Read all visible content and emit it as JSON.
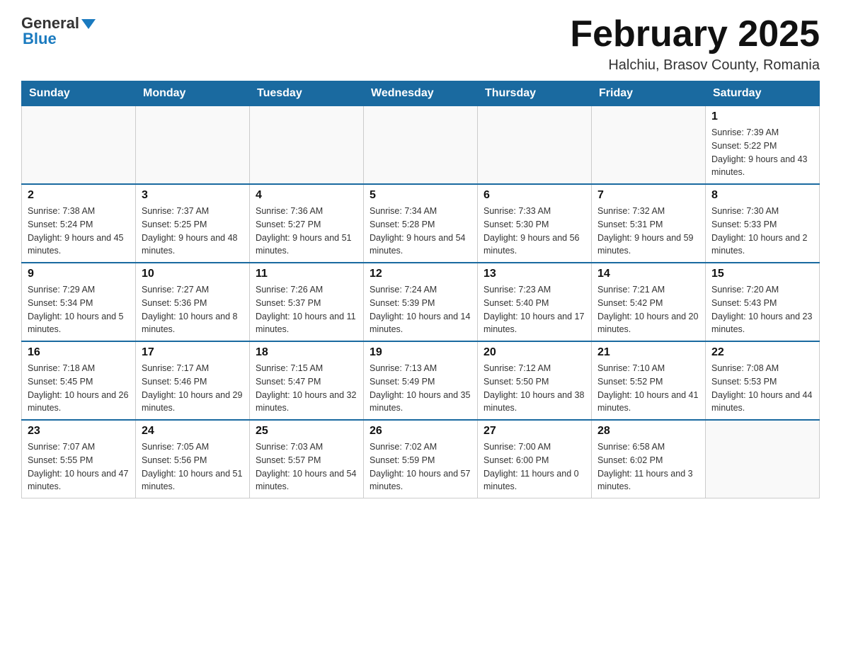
{
  "header": {
    "logo_general": "General",
    "logo_blue": "Blue",
    "title": "February 2025",
    "subtitle": "Halchiu, Brasov County, Romania"
  },
  "weekdays": [
    "Sunday",
    "Monday",
    "Tuesday",
    "Wednesday",
    "Thursday",
    "Friday",
    "Saturday"
  ],
  "weeks": [
    [
      {
        "day": "",
        "sunrise": "",
        "sunset": "",
        "daylight": ""
      },
      {
        "day": "",
        "sunrise": "",
        "sunset": "",
        "daylight": ""
      },
      {
        "day": "",
        "sunrise": "",
        "sunset": "",
        "daylight": ""
      },
      {
        "day": "",
        "sunrise": "",
        "sunset": "",
        "daylight": ""
      },
      {
        "day": "",
        "sunrise": "",
        "sunset": "",
        "daylight": ""
      },
      {
        "day": "",
        "sunrise": "",
        "sunset": "",
        "daylight": ""
      },
      {
        "day": "1",
        "sunrise": "Sunrise: 7:39 AM",
        "sunset": "Sunset: 5:22 PM",
        "daylight": "Daylight: 9 hours and 43 minutes."
      }
    ],
    [
      {
        "day": "2",
        "sunrise": "Sunrise: 7:38 AM",
        "sunset": "Sunset: 5:24 PM",
        "daylight": "Daylight: 9 hours and 45 minutes."
      },
      {
        "day": "3",
        "sunrise": "Sunrise: 7:37 AM",
        "sunset": "Sunset: 5:25 PM",
        "daylight": "Daylight: 9 hours and 48 minutes."
      },
      {
        "day": "4",
        "sunrise": "Sunrise: 7:36 AM",
        "sunset": "Sunset: 5:27 PM",
        "daylight": "Daylight: 9 hours and 51 minutes."
      },
      {
        "day": "5",
        "sunrise": "Sunrise: 7:34 AM",
        "sunset": "Sunset: 5:28 PM",
        "daylight": "Daylight: 9 hours and 54 minutes."
      },
      {
        "day": "6",
        "sunrise": "Sunrise: 7:33 AM",
        "sunset": "Sunset: 5:30 PM",
        "daylight": "Daylight: 9 hours and 56 minutes."
      },
      {
        "day": "7",
        "sunrise": "Sunrise: 7:32 AM",
        "sunset": "Sunset: 5:31 PM",
        "daylight": "Daylight: 9 hours and 59 minutes."
      },
      {
        "day": "8",
        "sunrise": "Sunrise: 7:30 AM",
        "sunset": "Sunset: 5:33 PM",
        "daylight": "Daylight: 10 hours and 2 minutes."
      }
    ],
    [
      {
        "day": "9",
        "sunrise": "Sunrise: 7:29 AM",
        "sunset": "Sunset: 5:34 PM",
        "daylight": "Daylight: 10 hours and 5 minutes."
      },
      {
        "day": "10",
        "sunrise": "Sunrise: 7:27 AM",
        "sunset": "Sunset: 5:36 PM",
        "daylight": "Daylight: 10 hours and 8 minutes."
      },
      {
        "day": "11",
        "sunrise": "Sunrise: 7:26 AM",
        "sunset": "Sunset: 5:37 PM",
        "daylight": "Daylight: 10 hours and 11 minutes."
      },
      {
        "day": "12",
        "sunrise": "Sunrise: 7:24 AM",
        "sunset": "Sunset: 5:39 PM",
        "daylight": "Daylight: 10 hours and 14 minutes."
      },
      {
        "day": "13",
        "sunrise": "Sunrise: 7:23 AM",
        "sunset": "Sunset: 5:40 PM",
        "daylight": "Daylight: 10 hours and 17 minutes."
      },
      {
        "day": "14",
        "sunrise": "Sunrise: 7:21 AM",
        "sunset": "Sunset: 5:42 PM",
        "daylight": "Daylight: 10 hours and 20 minutes."
      },
      {
        "day": "15",
        "sunrise": "Sunrise: 7:20 AM",
        "sunset": "Sunset: 5:43 PM",
        "daylight": "Daylight: 10 hours and 23 minutes."
      }
    ],
    [
      {
        "day": "16",
        "sunrise": "Sunrise: 7:18 AM",
        "sunset": "Sunset: 5:45 PM",
        "daylight": "Daylight: 10 hours and 26 minutes."
      },
      {
        "day": "17",
        "sunrise": "Sunrise: 7:17 AM",
        "sunset": "Sunset: 5:46 PM",
        "daylight": "Daylight: 10 hours and 29 minutes."
      },
      {
        "day": "18",
        "sunrise": "Sunrise: 7:15 AM",
        "sunset": "Sunset: 5:47 PM",
        "daylight": "Daylight: 10 hours and 32 minutes."
      },
      {
        "day": "19",
        "sunrise": "Sunrise: 7:13 AM",
        "sunset": "Sunset: 5:49 PM",
        "daylight": "Daylight: 10 hours and 35 minutes."
      },
      {
        "day": "20",
        "sunrise": "Sunrise: 7:12 AM",
        "sunset": "Sunset: 5:50 PM",
        "daylight": "Daylight: 10 hours and 38 minutes."
      },
      {
        "day": "21",
        "sunrise": "Sunrise: 7:10 AM",
        "sunset": "Sunset: 5:52 PM",
        "daylight": "Daylight: 10 hours and 41 minutes."
      },
      {
        "day": "22",
        "sunrise": "Sunrise: 7:08 AM",
        "sunset": "Sunset: 5:53 PM",
        "daylight": "Daylight: 10 hours and 44 minutes."
      }
    ],
    [
      {
        "day": "23",
        "sunrise": "Sunrise: 7:07 AM",
        "sunset": "Sunset: 5:55 PM",
        "daylight": "Daylight: 10 hours and 47 minutes."
      },
      {
        "day": "24",
        "sunrise": "Sunrise: 7:05 AM",
        "sunset": "Sunset: 5:56 PM",
        "daylight": "Daylight: 10 hours and 51 minutes."
      },
      {
        "day": "25",
        "sunrise": "Sunrise: 7:03 AM",
        "sunset": "Sunset: 5:57 PM",
        "daylight": "Daylight: 10 hours and 54 minutes."
      },
      {
        "day": "26",
        "sunrise": "Sunrise: 7:02 AM",
        "sunset": "Sunset: 5:59 PM",
        "daylight": "Daylight: 10 hours and 57 minutes."
      },
      {
        "day": "27",
        "sunrise": "Sunrise: 7:00 AM",
        "sunset": "Sunset: 6:00 PM",
        "daylight": "Daylight: 11 hours and 0 minutes."
      },
      {
        "day": "28",
        "sunrise": "Sunrise: 6:58 AM",
        "sunset": "Sunset: 6:02 PM",
        "daylight": "Daylight: 11 hours and 3 minutes."
      },
      {
        "day": "",
        "sunrise": "",
        "sunset": "",
        "daylight": ""
      }
    ]
  ]
}
